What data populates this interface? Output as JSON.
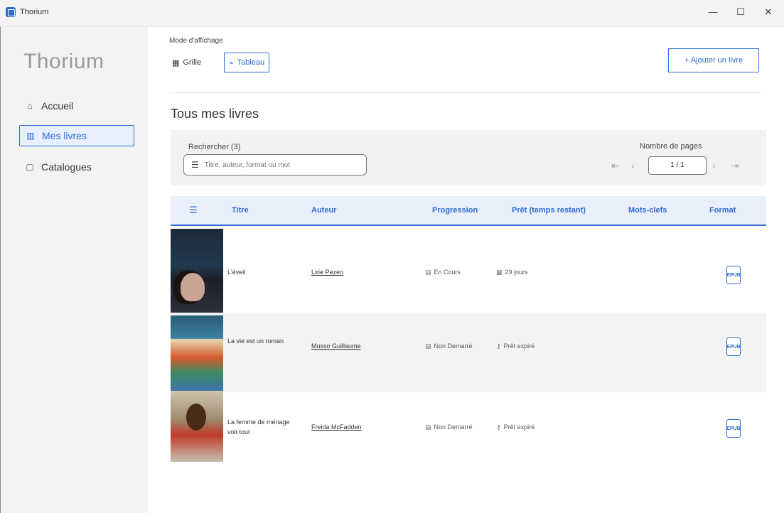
{
  "window": {
    "title": "Thorium",
    "minimize": "—",
    "maximize": "☐",
    "close": "✕"
  },
  "sidebar": {
    "brand": "Thorium",
    "items": [
      {
        "label": "Accueil",
        "icon": "home-icon"
      },
      {
        "label": "Mes livres",
        "icon": "books-icon",
        "active": true
      },
      {
        "label": "Catalogues",
        "icon": "catalog-icon"
      }
    ]
  },
  "toolbar": {
    "view_label": "Mode d'affichage",
    "grid_label": "Grille",
    "table_label": "Tableau",
    "add_book_label": "+ Ajouter un livre"
  },
  "page": {
    "title": "Tous mes livres"
  },
  "search": {
    "label": "Rechercher (3)",
    "placeholder": "Titre, auteur, format ou mot"
  },
  "pagination": {
    "label": "Nombre de pages",
    "value": "1 / 1"
  },
  "table": {
    "headers": {
      "title": "Titre",
      "author": "Auteur",
      "progress": "Progression",
      "loan": "Prêt (temps restant)",
      "keywords": "Mots-clefs",
      "format": "Format"
    },
    "rows": [
      {
        "title": "L'éveil",
        "author": "Lirie Pezen",
        "progress": "En Cours",
        "loan": "29 jours",
        "format": "EPUB"
      },
      {
        "title": "La vie est un roman",
        "author": "Musso Guillaume",
        "progress": "Non Demarré",
        "loan": "Prêt expiré",
        "format": "EPUB"
      },
      {
        "title": "La femme de ménage voit tout",
        "author": "Freida McFadden",
        "progress": "Non Demarré",
        "loan": "Prêt expiré",
        "format": "EPUB"
      }
    ]
  },
  "colors": {
    "accent": "#2f6ad6",
    "sidebar_bg": "#f3f3f3",
    "header_bg": "#e9f0fb"
  }
}
